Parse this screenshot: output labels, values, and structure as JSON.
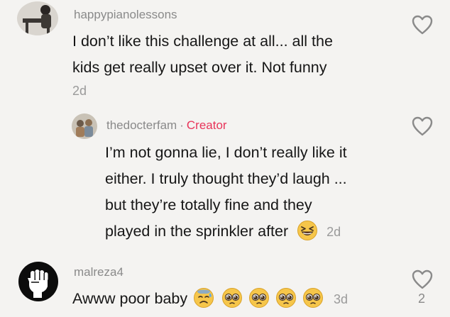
{
  "comments": [
    {
      "username": "happypianolessons",
      "text_lines": [
        "I don’t like this challenge at all... all the",
        "kids get really upset over it. Not funny"
      ],
      "age": "2d",
      "icons": [
        "avatar-photo",
        "heart-outline-icon"
      ]
    },
    {
      "username": "thedocterfam",
      "separator": "·",
      "badge": "Creator",
      "text_lines": [
        "I’m not gonna lie, I don’t really like it",
        "either. I truly thought they’d laugh ...",
        "but they’re totally fine and they",
        "played in the sprinkler after"
      ],
      "age": "2d",
      "icons": [
        "avatar-photo",
        "grinning-squinting-face-emoji",
        "heart-outline-icon"
      ]
    },
    {
      "username": "malreza4",
      "text": "Awww poor baby",
      "age": "3d",
      "like_count": "2",
      "icons": [
        "raised-fist-avatar-icon",
        "sweat-face-emoji",
        "pleading-face-emoji",
        "heart-outline-icon"
      ]
    }
  ],
  "colors": {
    "background": "#f4f3f1",
    "creator": "#e8345a",
    "meta": "#8a8a8a"
  }
}
